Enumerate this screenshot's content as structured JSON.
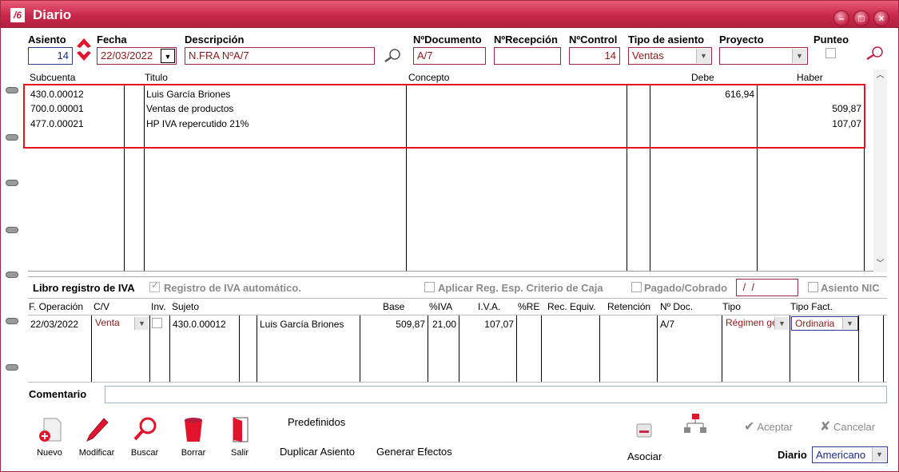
{
  "window": {
    "title": "Diario",
    "app_icon": "/6"
  },
  "header": {
    "asiento_label": "Asiento",
    "asiento_value": "14",
    "fecha_label": "Fecha",
    "fecha_value": "22/03/2022",
    "descripcion_label": "Descripción",
    "descripcion_value": "N.FRA NºA/7",
    "ndocumento_label": "NºDocumento",
    "ndocumento_value": "A/7",
    "nrecepcion_label": "NºRecepción",
    "nrecepcion_value": "",
    "ncontrol_label": "NºControl",
    "ncontrol_value": "14",
    "tipo_label": "Tipo de asiento",
    "tipo_value": "Ventas",
    "proyecto_label": "Proyecto",
    "proyecto_value": "",
    "punteo_label": "Punteo"
  },
  "entries": {
    "columns": [
      "Subcuenta",
      "Titulo",
      "Concepto",
      "Debe",
      "Haber"
    ],
    "rows": [
      {
        "subcuenta": "430.0.00012",
        "titulo": "Luis García Briones",
        "concepto": "",
        "debe": "616,94",
        "haber": ""
      },
      {
        "subcuenta": "700.0.00001",
        "titulo": "Ventas de productos",
        "concepto": "",
        "debe": "",
        "haber": "509,87"
      },
      {
        "subcuenta": "477.0.00021",
        "titulo": "HP IVA repercutido 21%",
        "concepto": "",
        "debe": "",
        "haber": "107,07"
      }
    ]
  },
  "iva": {
    "libro_label": "Libro registro de IVA",
    "auto_label": "Registro de IVA automático.",
    "caja_label": "Aplicar Reg. Esp. Criterio de Caja",
    "pagado_label": "Pagado/Cobrado",
    "pagado_value": " /  /",
    "nic_label": "Asiento NIC",
    "columns": [
      "F. Operación",
      "C/V",
      "Inv.",
      "Sujeto",
      "Base",
      "%IVA",
      "I.V.A.",
      "%RE",
      "Rec. Equiv.",
      "Retención",
      "Nº Doc.",
      "Tipo",
      "Tipo Fact."
    ],
    "row": {
      "fecha": "22/03/2022",
      "cv": "Venta",
      "sujeto_cuenta": "430.0.00012",
      "sujeto_nombre": "Luis García Briones",
      "base": "509,87",
      "iva_pct": "21,00",
      "iva": "107,07",
      "doc": "A/7",
      "tipo": "Régimen ge",
      "tipo_fact": "Ordinaria"
    }
  },
  "comentario_label": "Comentario",
  "toolbar": {
    "nuevo": "Nuevo",
    "modificar": "Modificar",
    "buscar": "Buscar",
    "borrar": "Borrar",
    "salir": "Salir",
    "predefinidos": "Predefinidos",
    "duplicar": "Duplicar Asiento",
    "generar": "Generar Efectos",
    "asociar": "Asociar",
    "aceptar": "Aceptar",
    "cancelar": "Cancelar",
    "diario_label": "Diario",
    "diario_value": "Americano"
  },
  "colors": {
    "title_bar": "#c8284c",
    "highlight_box": "#e3141d",
    "field_border": "#9d2a44",
    "text_red": "#8a1a1a"
  }
}
